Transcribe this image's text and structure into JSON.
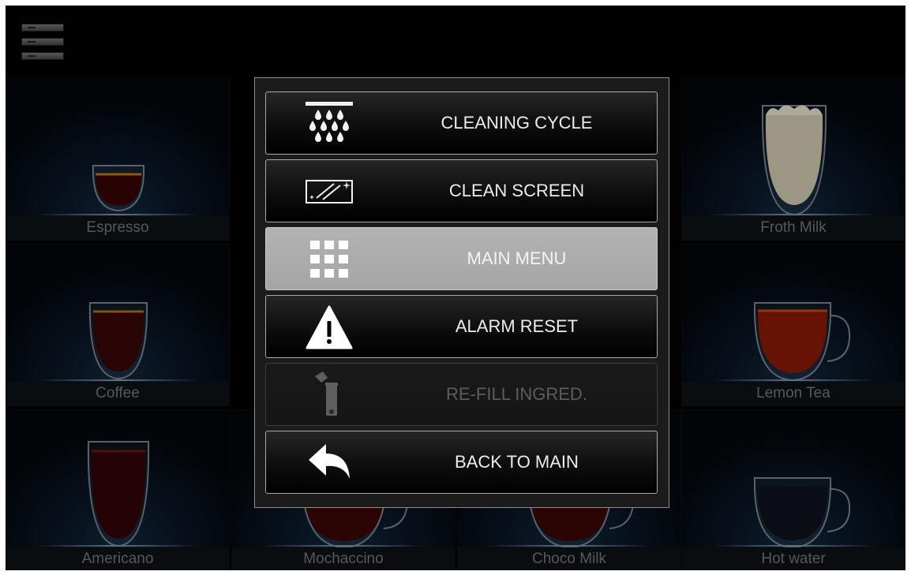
{
  "menu_icon": "hamburger-menu-icon",
  "drinks": [
    {
      "label": "Espresso",
      "icon": "espresso-cup-icon"
    },
    {
      "label": "Froth Milk",
      "icon": "froth-milk-glass-icon"
    },
    {
      "label": "Coffee",
      "icon": "coffee-glass-icon"
    },
    {
      "label": "Lemon Tea",
      "icon": "lemon-tea-mug-icon"
    },
    {
      "label": "Americano",
      "icon": "americano-glass-icon"
    },
    {
      "label": "Mochaccino",
      "icon": "mochaccino-mug-icon"
    },
    {
      "label": "Choco Milk",
      "icon": "choco-milk-mug-icon"
    },
    {
      "label": "Hot water",
      "icon": "hot-water-mug-icon"
    }
  ],
  "modal": {
    "buttons": [
      {
        "label": "CLEANING CYCLE",
        "icon": "cleaning-cycle-icon",
        "state": "normal"
      },
      {
        "label": "CLEAN SCREEN",
        "icon": "clean-screen-icon",
        "state": "normal"
      },
      {
        "label": "MAIN MENU",
        "icon": "grid-menu-icon",
        "state": "selected"
      },
      {
        "label": "ALARM RESET",
        "icon": "warning-icon",
        "state": "normal"
      },
      {
        "label": "RE-FILL INGRED.",
        "icon": "refill-ingredients-icon",
        "state": "disabled"
      },
      {
        "label": "BACK TO MAIN",
        "icon": "back-arrow-icon",
        "state": "normal"
      }
    ]
  },
  "colors": {
    "background": "#020203",
    "tile_glow": "#122840",
    "selected_button": "#a9a9a9",
    "disabled_text": "#5c5c5c"
  }
}
